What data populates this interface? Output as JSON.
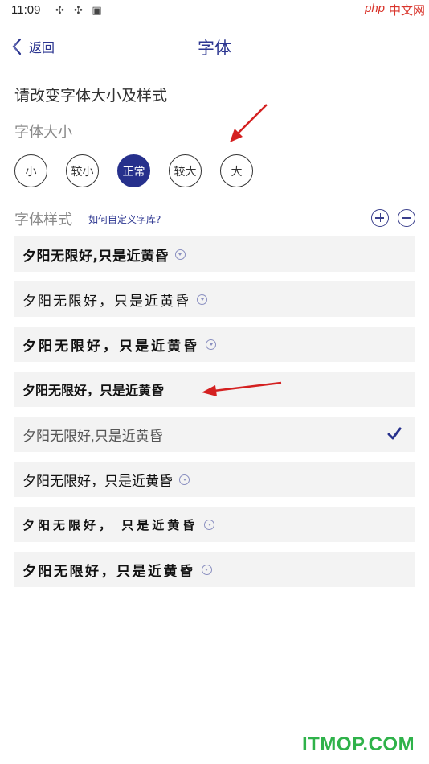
{
  "status_bar": {
    "time": "11:09",
    "icons": [
      "sync-icon",
      "sync-icon",
      "notification-icon"
    ]
  },
  "watermarks": {
    "php": "php",
    "cn": "中文网",
    "itmop": "ITMOP.COM"
  },
  "header": {
    "back_label": "返回",
    "title": "字体"
  },
  "subtitle": "请改变字体大小及样式",
  "size_section": {
    "label": "字体大小",
    "options": [
      "小",
      "较小",
      "正常",
      "较大",
      "大"
    ],
    "selected": "正常"
  },
  "style_section": {
    "label": "字体样式",
    "help_link": "如何自定义字库?",
    "fonts": [
      {
        "text": "夕阳无限好,只是近黄昏",
        "downloadable": true,
        "selected": false
      },
      {
        "text": "夕阳无限好，只是近黄昏",
        "downloadable": true,
        "selected": false
      },
      {
        "text": "夕阳无限好，只是近黄昏",
        "downloadable": true,
        "selected": false
      },
      {
        "text": "夕阳无限好，只是近黄昏",
        "downloadable": false,
        "selected": false
      },
      {
        "text": "夕阳无限好,只是近黄昏",
        "downloadable": false,
        "selected": true
      },
      {
        "text": "夕阳无限好，只是近黄昏",
        "downloadable": true,
        "selected": false
      },
      {
        "text": "夕阳无限好， 只是近黄昏",
        "downloadable": true,
        "selected": false
      },
      {
        "text": "夕阳无限好，只是近黄昏",
        "downloadable": true,
        "selected": false
      }
    ]
  },
  "colors": {
    "accent": "#26308c",
    "annotation_arrow": "#d42020",
    "item_background": "#f3f3f3"
  }
}
